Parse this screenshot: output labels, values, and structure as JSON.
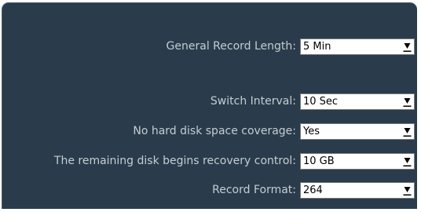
{
  "settings": {
    "general_record_length": {
      "label": "General Record Length:",
      "value": "5 Min"
    },
    "switch_interval": {
      "label": "Switch Interval:",
      "value": "10 Sec"
    },
    "no_hard_disk_space_coverage": {
      "label": "No hard disk space coverage:",
      "value": "Yes"
    },
    "remaining_disk_recovery_control": {
      "label": "The remaining disk begins recovery control:",
      "value": "10 GB"
    },
    "record_format": {
      "label": "Record Format:",
      "value": "264"
    }
  },
  "icons": {
    "dropdown": "chevron-down-icon"
  }
}
